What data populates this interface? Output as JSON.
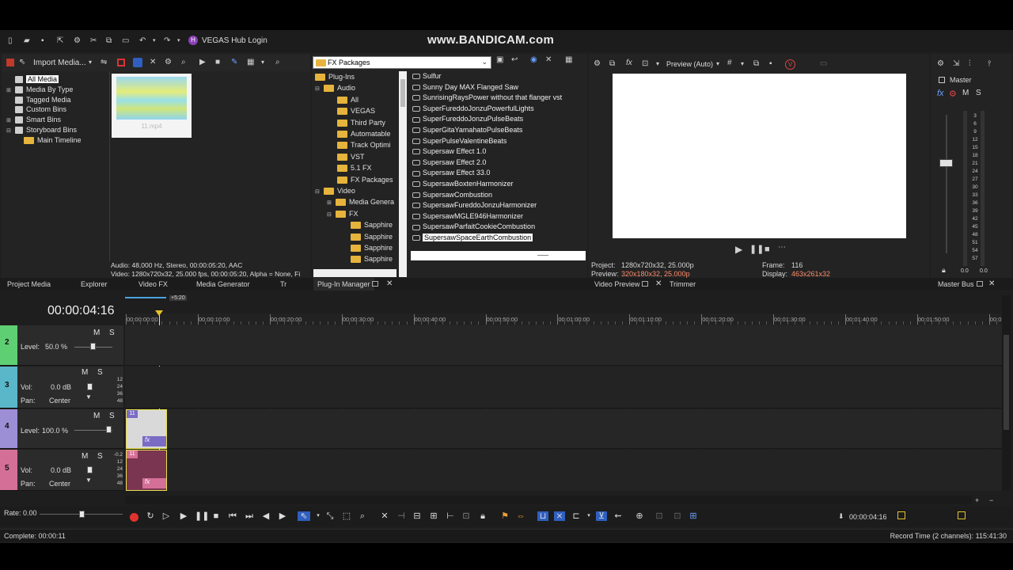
{
  "watermark": "www.BANDICAM.com",
  "hub": {
    "label": "VEGAS Hub Login"
  },
  "explorer": {
    "dropdown_label": "Import Media...",
    "tree": [
      "All Media",
      "Media By Type",
      "Tagged Media",
      "Custom Bins",
      "Smart Bins",
      "Storyboard Bins",
      "Main Timeline"
    ],
    "thumb_label": "11.mp4",
    "info_line1": "Audio: 48,000 Hz, Stereo, 00:00:05:20, AAC",
    "info_line2": "Video: 1280x720x32, 25.000 fps, 00:00:05:20, Alpha = None, Fi"
  },
  "plugin_manager": {
    "path": "FX Packages",
    "tree": [
      "Plug-Ins",
      "Audio",
      "All",
      "VEGAS",
      "Third Party",
      "Automatable",
      "Track Optimi",
      "VST",
      "5.1 FX",
      "FX Packages",
      "Video",
      "Media Genera",
      "FX",
      "Sapphire",
      "Sapphire",
      "Sapphire",
      "Sapphire"
    ],
    "items": [
      "Sulfur",
      "Sunny Day MAX Flanged Saw",
      "SunrisingRaysPower without that flanger vst",
      "SuperFureddoJonzuPowerfulLights",
      "SuperFureddoJonzuPulseBeats",
      "SuperGitaYamahatoPulseBeats",
      "SuperPulseValentineBeats",
      "Supersaw Effect 1.0",
      "Supersaw Effect 2.0",
      "Supersaw Effect 33.0",
      "SupersawBoxtenHarmonizer",
      "SupersawCombustion",
      "SupersawFureddoJonzuHarmonizer",
      "SupersawMGLE946Harmonizer",
      "SupersawParfaitCookieCombustion",
      "SupersawSpaceEarthCombustion"
    ]
  },
  "preview": {
    "mode": "Preview (Auto)",
    "project_label": "Project:",
    "project_value": "1280x720x32, 25.000p",
    "preview_label": "Preview:",
    "preview_value": "320x180x32, 25.000p",
    "frame_label": "Frame:",
    "frame_value": "116",
    "display_label": "Display:",
    "display_value": "463x261x32"
  },
  "master": {
    "title": "Master",
    "fx": "fx",
    "m": "M",
    "s": "S",
    "scale": [
      "3",
      "6",
      "9",
      "12",
      "15",
      "18",
      "21",
      "24",
      "27",
      "30",
      "33",
      "36",
      "39",
      "42",
      "45",
      "48",
      "51",
      "54",
      "57"
    ],
    "peak_l": "0.0",
    "peak_r": "0.0"
  },
  "tabs": {
    "project_media": "Project Media",
    "explorer": "Explorer",
    "video_fx": "Video FX",
    "media_generator": "Media Generator",
    "transitions": "Tr",
    "plugin_manager": "Plug-In Manager",
    "video_preview": "Video Preview",
    "trimmer": "Trimmer",
    "master_bus": "Master Bus"
  },
  "timeline": {
    "timecode": "00:00:04:16",
    "loop_label": "+5:20",
    "ruler": [
      "00:00:00:00",
      "00:00:10:00",
      "00:00:20:00",
      "00:00:30:00",
      "00:00:40:00",
      "00:00:50:00",
      "00:01:00:00",
      "00:01:10:00",
      "00:01:20:00",
      "00:01:30:00",
      "00:01:40:00",
      "00:01:50:00",
      "00:0"
    ],
    "tracks": [
      {
        "num": "2",
        "color": "#5fcf74",
        "type": "video",
        "label": "Level:",
        "value": "50.0 %"
      },
      {
        "num": "3",
        "color": "#5ab7c9",
        "type": "audio",
        "vol_label": "Vol:",
        "vol": "0.0 dB",
        "pan_label": "Pan:",
        "pan": "Center"
      },
      {
        "num": "4",
        "color": "#9c8fd6",
        "type": "video",
        "label": "Level:",
        "value": "100.0 %"
      },
      {
        "num": "5",
        "color": "#d46f98",
        "type": "audio",
        "vol_label": "Vol:",
        "vol": "0.0 dB",
        "pan_label": "Pan:",
        "pan": "Center"
      }
    ],
    "meter_scale": [
      "12",
      "24",
      "36",
      "48"
    ],
    "meter_scale_b": [
      "-0.2",
      "12",
      "24",
      "36",
      "48"
    ],
    "clip_label": "11",
    "clip_fx": "fx",
    "m": "M",
    "s": "S"
  },
  "rate": "Rate: 0.00",
  "cursor_time": "00:00:04:16",
  "status": {
    "left": "Complete: 00:00:11",
    "right": "Record Time (2 channels): 115:41:30"
  }
}
